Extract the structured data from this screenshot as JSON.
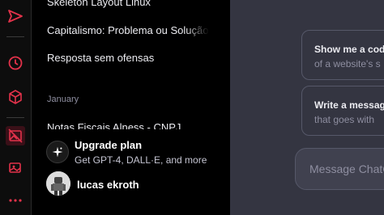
{
  "rail": {
    "icons": [
      "send-icon",
      "clock-icon",
      "cube-icon",
      "image-off-icon",
      "gallery-icon",
      "more-icon"
    ],
    "accent": "#e2324a"
  },
  "sidebar": {
    "history_top": [
      "Skeleton Layout Linux",
      "Capitalismo: Problema ou Solução",
      "Resposta sem ofensas"
    ],
    "group_label": "January",
    "history_january": [
      "Notas Fiscais Alness - CNPJ"
    ]
  },
  "upgrade": {
    "title": "Upgrade plan",
    "subtitle": "Get GPT-4, DALL·E, and more"
  },
  "user": {
    "name": "lucas ekroth"
  },
  "suggestions": [
    {
      "title": "Show me a code",
      "subtitle": "of a website's s"
    },
    {
      "title": "Write a message",
      "subtitle": "that goes with"
    }
  ],
  "composer": {
    "placeholder": "Message ChatGPT"
  }
}
